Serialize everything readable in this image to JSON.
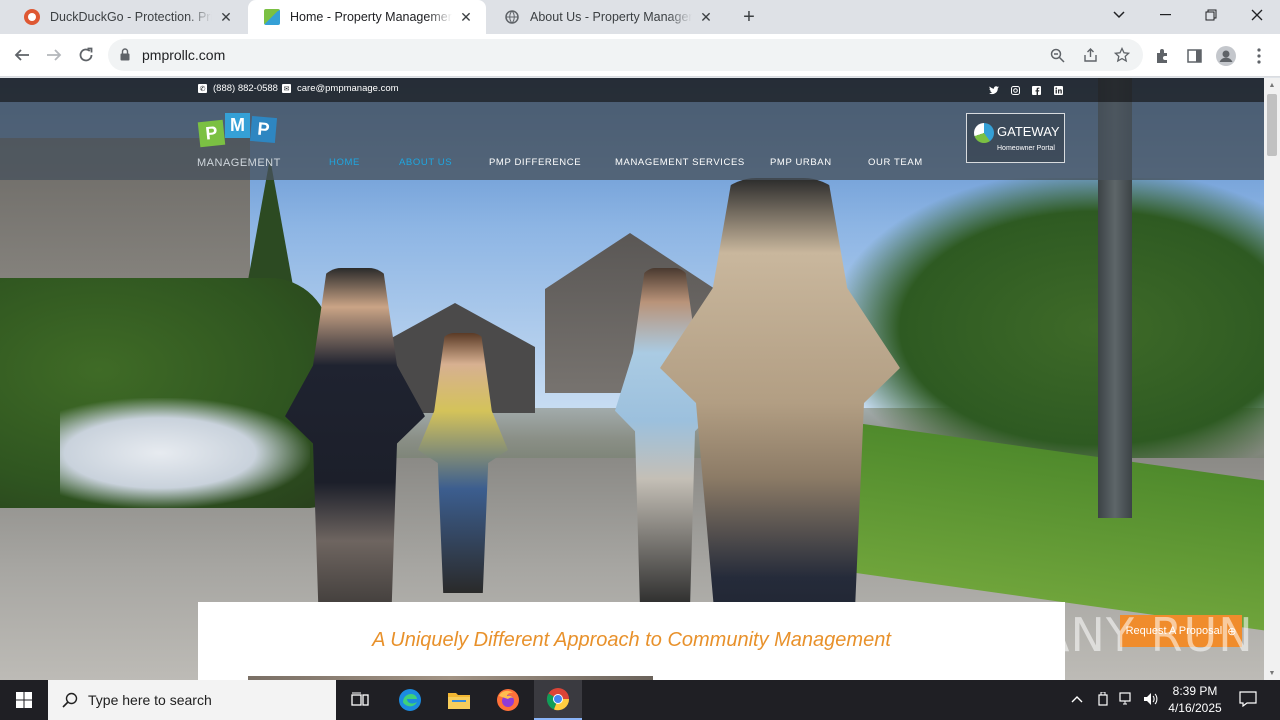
{
  "browser": {
    "tabs": [
      {
        "title": "DuckDuckGo - Protection. Privacy",
        "active": false,
        "icon": "duckduckgo-icon"
      },
      {
        "title": "Home - Property Management Pro",
        "active": true,
        "icon": "pmp-favicon"
      },
      {
        "title": "About Us - Property Management",
        "active": false,
        "icon": "globe-icon"
      }
    ],
    "url": "pmprollc.com"
  },
  "site": {
    "phone": "(888) 882-0588",
    "email": "care@pmpmanage.com",
    "logo_letters": [
      "P",
      "M",
      "P"
    ],
    "logo_text": "MANAGEMENT",
    "nav": [
      {
        "label": "HOME",
        "current": true
      },
      {
        "label": "ABOUT US",
        "current": true
      },
      {
        "label": "PMP DIFFERENCE",
        "current": false
      },
      {
        "label": "MANAGEMENT SERVICES",
        "current": false
      },
      {
        "label": "PMP URBAN",
        "current": false
      },
      {
        "label": "OUR TEAM",
        "current": false
      }
    ],
    "gateway_title": "GATEWAY",
    "gateway_sub": "Homeowner Portal",
    "tagline": "A Uniquely Different Approach to Community Management",
    "proposal_label": "Request A Proposal",
    "social": [
      "twitter-icon",
      "instagram-icon",
      "facebook-icon",
      "linkedin-icon"
    ],
    "colors": {
      "accent_blue": "#1ea6e0",
      "tagline_orange": "#e8912b",
      "logo_green": "#7bc043",
      "logo_blue": "#35a0d6"
    }
  },
  "watermark": "ANY RUN",
  "taskbar": {
    "search_placeholder": "Type here to search",
    "time": "8:39 PM",
    "date": "4/16/2025"
  }
}
